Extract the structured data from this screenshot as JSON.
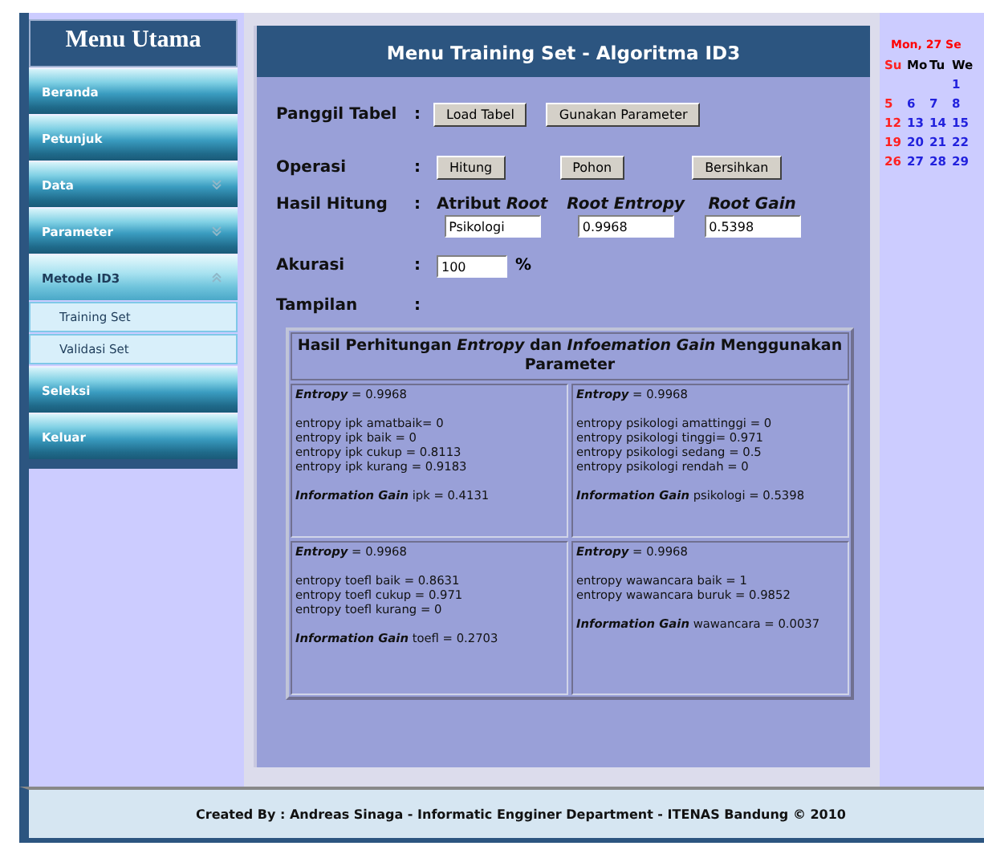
{
  "sidebar": {
    "title": "Menu Utama",
    "items": [
      {
        "label": "Beranda",
        "selected": false
      },
      {
        "label": "Petunjuk",
        "selected": false
      },
      {
        "label": "Data",
        "selected": false,
        "expanded": false
      },
      {
        "label": "Parameter",
        "selected": false,
        "expanded": false
      },
      {
        "label": "Metode ID3",
        "selected": true,
        "expanded": true,
        "children": [
          {
            "label": "Training Set"
          },
          {
            "label": "Validasi Set"
          }
        ]
      },
      {
        "label": "Seleksi",
        "selected": false
      },
      {
        "label": "Keluar",
        "selected": false
      }
    ]
  },
  "panel": {
    "title": "Menu Training Set - Algoritma ID3",
    "panggil": {
      "label": "Panggil Tabel",
      "colon": ":",
      "buttons": [
        "Load Tabel",
        "Gunakan Parameter"
      ]
    },
    "operasi": {
      "label": "Operasi",
      "colon": ":",
      "buttons": [
        "Hitung",
        "Pohon",
        "Bersihkan"
      ]
    },
    "hasil": {
      "label": "Hasil Hitung",
      "colon": ":",
      "fields": [
        {
          "label": "Atribut *Root*",
          "value": "Psikologi"
        },
        {
          "label": "Root Entropy",
          "value": "0.9968"
        },
        {
          "label": "Root Gain",
          "value": "0.5398"
        }
      ]
    },
    "akurasi": {
      "label": "Akurasi",
      "colon": ":",
      "value": "100",
      "unit": "%"
    },
    "tampilan": {
      "label": "Tampilan",
      "colon": ":"
    },
    "result": {
      "title": "Hasil Perhitungan *Entropy* dan *Infoemation Gain* Menggunakan Parameter",
      "cells": [
        {
          "entropy_term": "Entropy",
          "entropy_value": "= 0.9968",
          "lines": [
            "entropy ipk amatbaik= 0",
            "entropy ipk baik = 0",
            "entropy ipk cukup = 0.8113",
            "entropy ipk kurang = 0.9183"
          ],
          "gain_term": "Information Gain",
          "gain_value": "ipk = 0.4131"
        },
        {
          "entropy_term": "Entropy",
          "entropy_value": "= 0.9968",
          "lines": [
            "entropy psikologi amattinggi = 0",
            "entropy psikologi tinggi= 0.971",
            "entropy psikologi sedang = 0.5",
            "entropy psikologi rendah = 0"
          ],
          "gain_term": "Information Gain",
          "gain_value": "psikologi = 0.5398"
        },
        {
          "entropy_term": "Entropy",
          "entropy_value": "= 0.9968",
          "lines": [
            "entropy toefl baik = 0.8631",
            "entropy toefl cukup = 0.971",
            "entropy toefl kurang = 0"
          ],
          "gain_term": "Information Gain",
          "gain_value": "toefl = 0.2703"
        },
        {
          "entropy_term": "Entropy",
          "entropy_value": "= 0.9968",
          "lines": [
            "entropy wawancara baik = 1",
            "entropy wawancara buruk = 0.9852"
          ],
          "gain_term": "Information Gain",
          "gain_value": "wawancara = 0.0037"
        }
      ]
    }
  },
  "calendar": {
    "title": "Mon, 27 Se",
    "weekdays": [
      "Su",
      "Mo",
      "Tu",
      "We"
    ],
    "weeks": [
      [
        "1"
      ],
      [
        "5",
        "6",
        "7",
        "8"
      ],
      [
        "12",
        "13",
        "14",
        "15"
      ],
      [
        "19",
        "20",
        "21",
        "22"
      ],
      [
        "26",
        "27",
        "28",
        "29"
      ]
    ]
  },
  "footer": "Created By : Andreas Sinaga - Informatic Engginer Department - ITENAS Bandung © 2010"
}
